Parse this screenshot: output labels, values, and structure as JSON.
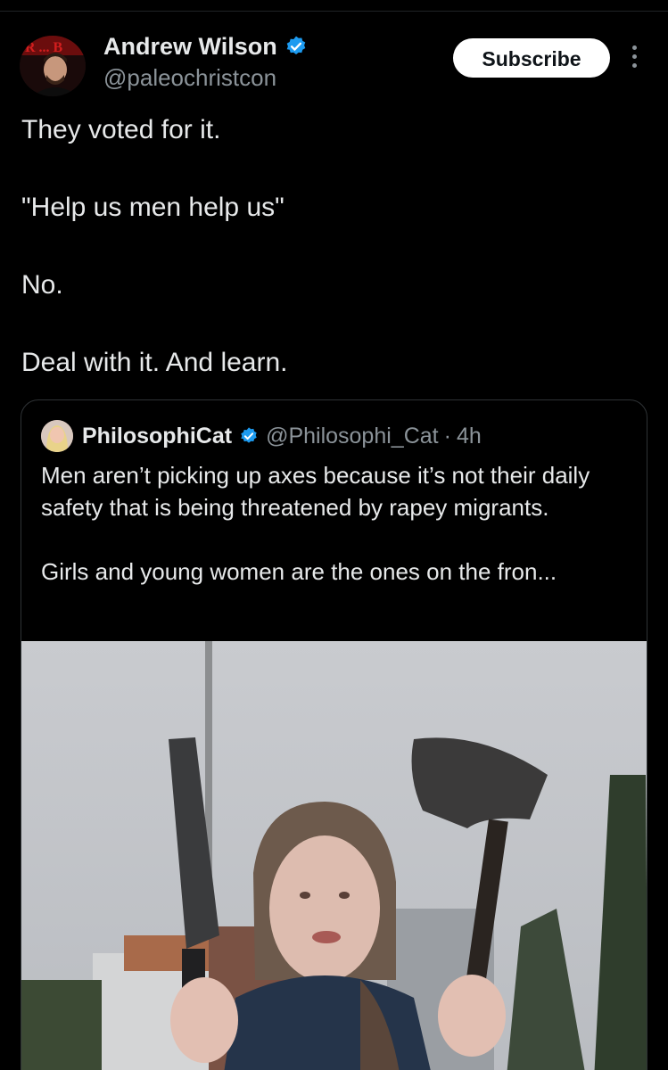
{
  "post": {
    "author_name": "Andrew Wilson",
    "author_handle": "@paleochristcon",
    "subscribe_label": "Subscribe",
    "avatar_icon": "avatar-image",
    "verified_icon": "verified-badge-icon",
    "more_icon": "more-vertical-icon",
    "lines": [
      "They voted for it.",
      "\"Help us men help us\"",
      "No.",
      "Deal with it. And learn."
    ]
  },
  "quoted_post": {
    "author_name": "PhilosophiCat",
    "author_handle": "@Philosophi_Cat",
    "separator": "·",
    "time": "4h",
    "paragraphs": [
      "Men aren’t picking up axes because it’s not their daily safety that is being threatened by rapey migrants.",
      "Girls and young women are the ones on the fron..."
    ],
    "media": "photo of a girl holding a knife and an axe"
  },
  "colors": {
    "background": "#000000",
    "text": "#e7e9ea",
    "secondary_text": "#8b9399",
    "verified": "#1d9bf0",
    "button_bg": "#ffffff"
  }
}
